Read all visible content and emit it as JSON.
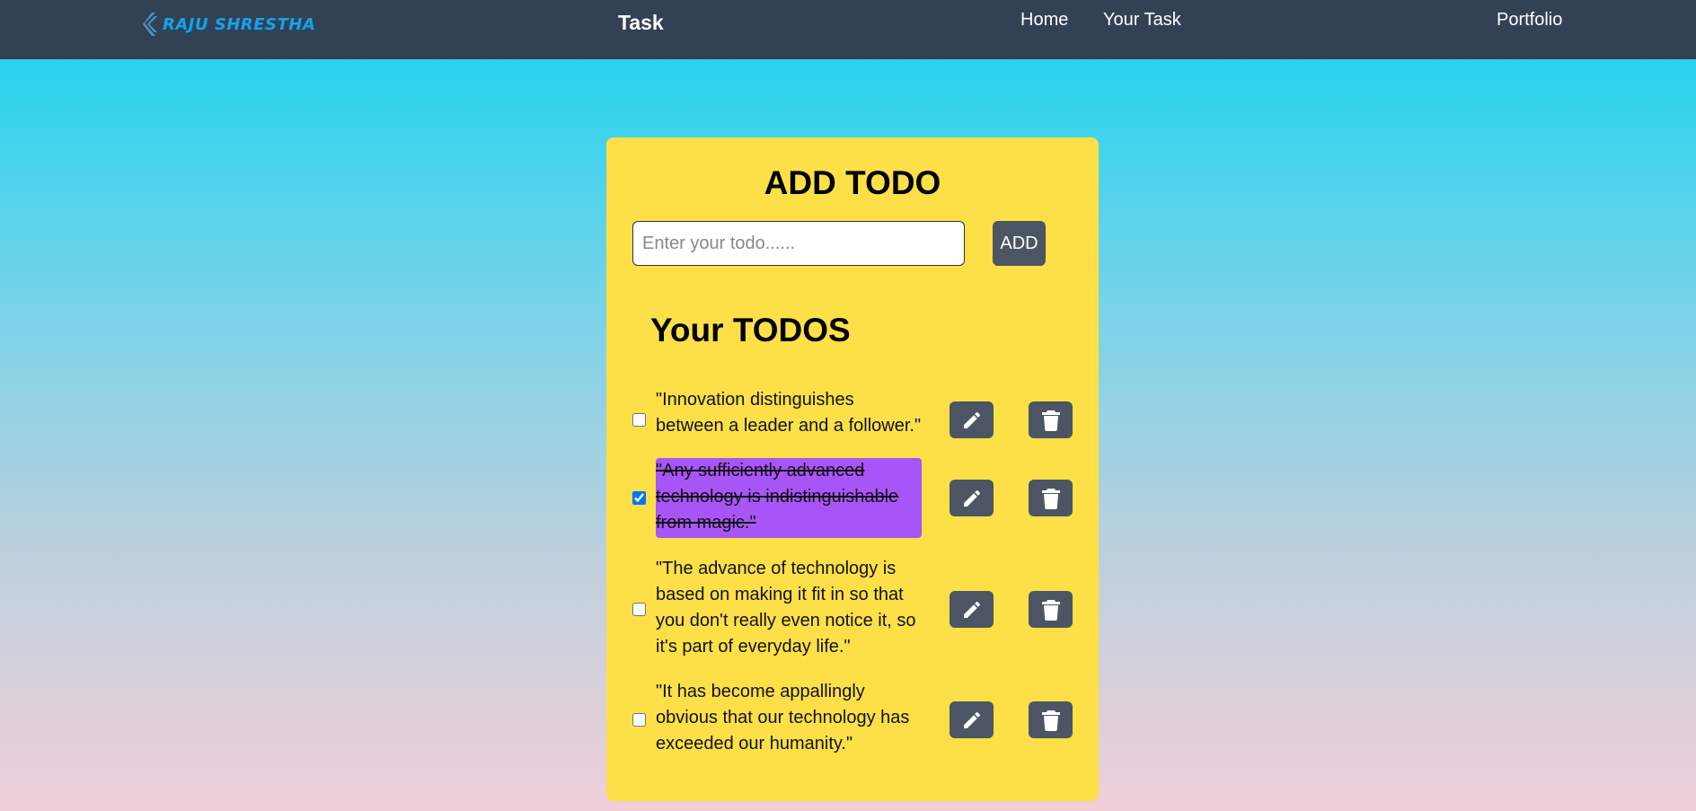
{
  "nav": {
    "brand": "RAJU SHRESTHA",
    "title": "Task",
    "links": [
      "Home",
      "Your Task"
    ],
    "portfolio": "Portfolio",
    "bg_color": "#334155"
  },
  "card": {
    "title": "ADD TODO",
    "input_placeholder": "Enter your todo......",
    "input_value": "",
    "add_label": "ADD",
    "todos_heading": "Your TODOS",
    "bg_color": "#fde047"
  },
  "todos": [
    {
      "text": "\"Innovation distinguishes between a leader and a follower.\"",
      "completed": false,
      "edit_icon": "pencil-icon",
      "delete_icon": "trash-icon"
    },
    {
      "text": "\"Any sufficiently advanced technology is indistinguishable from magic.\"",
      "completed": true,
      "edit_icon": "pencil-icon",
      "delete_icon": "trash-icon"
    },
    {
      "text": "\"The advance of technology is based on making it fit in so that you don't really even notice it, so it's part of everyday life.\"",
      "completed": false,
      "edit_icon": "pencil-icon",
      "delete_icon": "trash-icon"
    },
    {
      "text": "\"It has become appallingly obvious that our technology has exceeded our humanity.\"",
      "completed": false,
      "edit_icon": "pencil-icon",
      "delete_icon": "trash-icon"
    }
  ],
  "colors": {
    "button": "#4b5563",
    "completed_highlight": "#a855f7"
  }
}
